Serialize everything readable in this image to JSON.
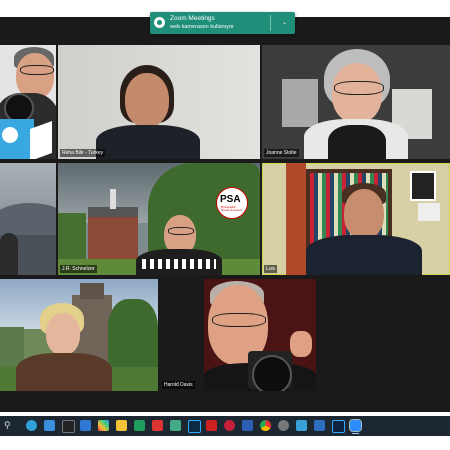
{
  "notification": {
    "title": "Zoom Meetings",
    "message": "web kamerasını kullanıyor"
  },
  "participants": [
    {
      "id": "p1",
      "name": ""
    },
    {
      "id": "p2",
      "name": "Reha Bilir - Turkey"
    },
    {
      "id": "p3",
      "name": "Joanne Stolte"
    },
    {
      "id": "p4",
      "name": ""
    },
    {
      "id": "p5",
      "name": "J.R. Schnelzer"
    },
    {
      "id": "p6",
      "name": "Luis"
    },
    {
      "id": "p7",
      "name": ""
    },
    {
      "id": "p8",
      "name": "Harold Davis"
    }
  ],
  "active_speaker": "Luis",
  "psa_logo": {
    "text": "PSA",
    "subtext": "Photographic Society of America"
  },
  "taskbar": {
    "icons": [
      "search-icon",
      "edge-icon",
      "store-icon",
      "terminal-icon",
      "mail-icon",
      "photos-icon",
      "explorer-icon",
      "sheets-icon",
      "pdf-icon",
      "camera-icon",
      "lightroom-icon",
      "acrobat-icon",
      "game-icon",
      "word-icon",
      "chrome-icon",
      "settings-icon",
      "vpn-icon",
      "wallet-icon",
      "photoshop-icon",
      "zoom-icon"
    ]
  }
}
